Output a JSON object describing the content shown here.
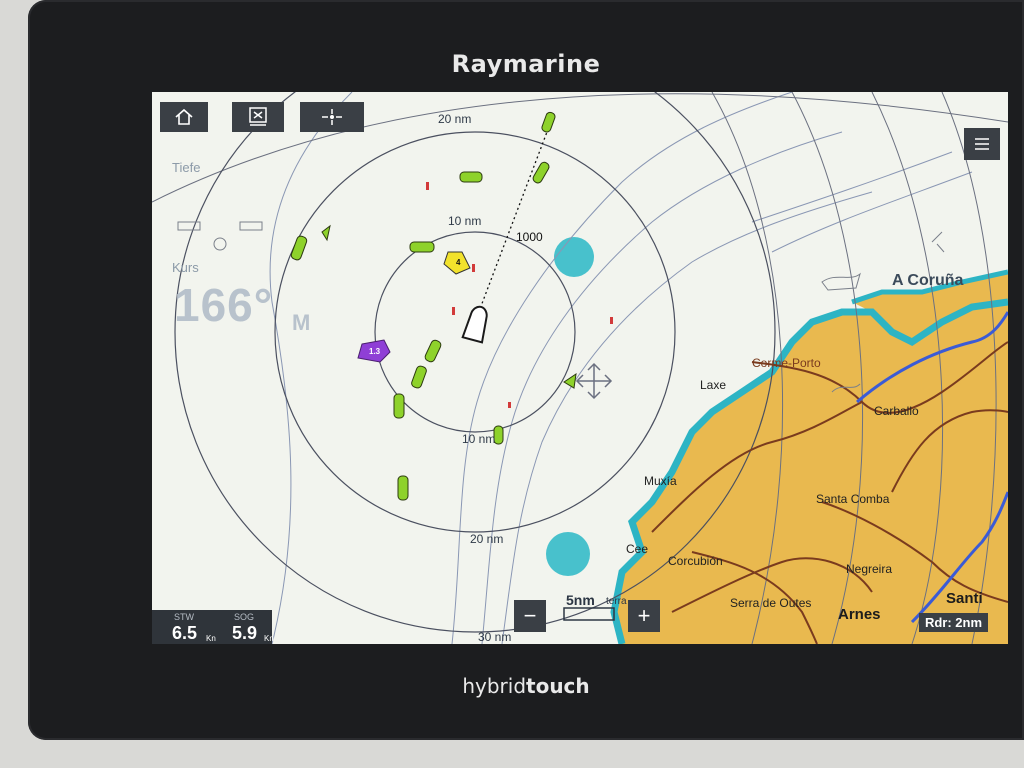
{
  "device": {
    "brand": "Raymarine",
    "model_prefix": "hybrid",
    "model_suffix": "touch"
  },
  "toolbar": {
    "home_icon": "home-icon",
    "mob_icon": "man-overboard-icon",
    "waypoint_icon": "waypoint-crosshair-icon",
    "menu_icon": "hamburger-menu-icon"
  },
  "overlay": {
    "depth_label": "Tiefe",
    "heading_label": "Kurs",
    "heading_value": "166°",
    "heading_unit": "M"
  },
  "rings": {
    "r10_top": "10 nm",
    "r10_bottom": "10 nm",
    "r20_top": "20 nm",
    "r20_bottom": "20 nm",
    "r30_bottom": "30 nm",
    "heading_distance": "1000"
  },
  "targets": {
    "purple_label": "1.3",
    "yellow_label": "4"
  },
  "places": {
    "a_coruna": "A Coruña",
    "corme_porto": "Corme-Porto",
    "laxe": "Laxe",
    "carballo": "Carballo",
    "muxia": "Muxía",
    "santa_comba": "Santa Comba",
    "cee": "Cee",
    "corcubion": "Corcubión",
    "negreira": "Negreira",
    "serra_de_outes": "Serra de Outes",
    "arnes": "Arnes",
    "santi": "Santi"
  },
  "status": {
    "stw_label": "STW",
    "stw_value": "6.5",
    "stw_unit": "Kn",
    "sog_label": "SOG",
    "sog_value": "5.9",
    "sog_unit": "Kn"
  },
  "zoom": {
    "minus": "−",
    "plus": "+",
    "scale": "5nm",
    "scale_suffix": "terra"
  },
  "radar_range": "Rdr: 2nm",
  "colors": {
    "sea": "#f2f4ee",
    "land": "#e9b94f",
    "coast": "#2db4c4",
    "road": "#7a3b1e",
    "river": "#3b5bd6",
    "target_green": "#8ed22b",
    "target_yellow": "#f2e22c",
    "target_purple": "#8f3fd6"
  }
}
